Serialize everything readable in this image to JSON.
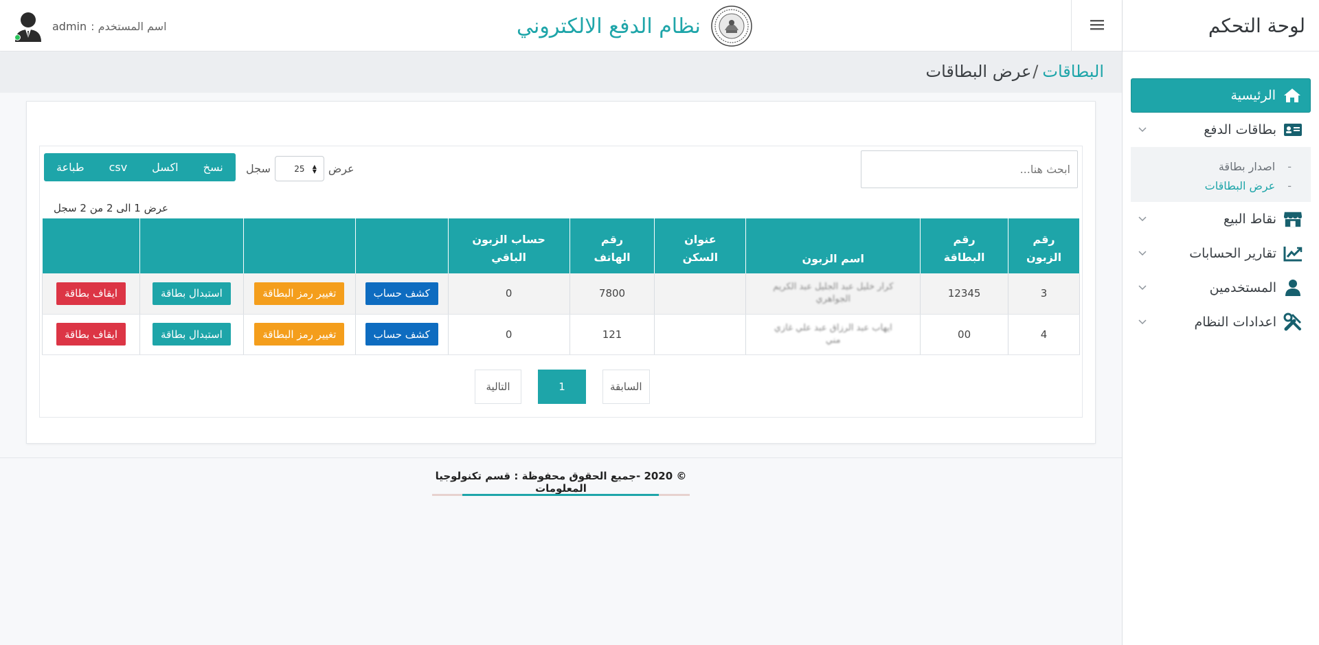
{
  "sidebar": {
    "title": "لوحة التحكم",
    "items": [
      {
        "label": "الرئيسية",
        "icon": "home-icon"
      },
      {
        "label": "بطاقات الدفع",
        "icon": "id-card-icon"
      },
      {
        "label": "نقاط البيع",
        "icon": "store-icon"
      },
      {
        "label": "تقارير الحسابات",
        "icon": "chart-line-icon"
      },
      {
        "label": "المستخدمين",
        "icon": "user-icon"
      },
      {
        "label": "اعدادات النظام",
        "icon": "tools-icon"
      }
    ],
    "submenu": [
      {
        "label": "اصدار بطاقة"
      },
      {
        "label": "عرض البطاقات"
      }
    ],
    "dash": "-"
  },
  "header": {
    "title": "نظام الدفع الالكتروني",
    "user_label": "اسم المستخدم :",
    "username": "admin"
  },
  "breadcrumb": {
    "parent": "البطاقات",
    "separator": "/",
    "current": "عرض البطاقات"
  },
  "toolbar": {
    "search_placeholder": "ابحث هنا...",
    "show_label": "عرض",
    "page_size": "25",
    "records_label": "سجل",
    "export_buttons": [
      "نسخ",
      "اكسل",
      "csv",
      "طباعة"
    ]
  },
  "info": "عرض 1 الى 2 من 2 سجل",
  "table": {
    "headers": [
      [
        "رقم",
        "الزبون"
      ],
      [
        "رقم",
        "البطاقة"
      ],
      [
        "اسم الزبون",
        ""
      ],
      [
        "عنوان",
        "السكن"
      ],
      [
        "رقم",
        "الهاتف"
      ],
      [
        "حساب الزبون",
        "الباقي"
      ],
      [
        "",
        ""
      ],
      [
        "",
        ""
      ],
      [
        "",
        ""
      ],
      [
        "",
        ""
      ]
    ],
    "rows": [
      {
        "customer_no": "3",
        "card_no": "12345",
        "name_line1": "كرار خليل عبد الجليل عبد الكريم",
        "name_line2": "الجواهري",
        "address": "",
        "phone": "7800",
        "balance": "0"
      },
      {
        "customer_no": "4",
        "card_no": "00",
        "name_line1": "ايهاب عبد الرزاق عبد علي غازي",
        "name_line2": "مني",
        "address": "",
        "phone": "121",
        "balance": "0"
      }
    ],
    "actions": {
      "statement": "كشف حساب",
      "change_pin": "تغيير رمز البطاقة",
      "replace": "استبدال بطاقة",
      "suspend": "ايقاف بطاقة"
    }
  },
  "pagination": {
    "previous": "السابقة",
    "current": "1",
    "next": "التالية"
  },
  "footer": {
    "text": "© 2020 -جميع الحقوق محفوظة : قسم تكنولوجيا المعلومات"
  },
  "colors": {
    "accent": "#1ea5a9",
    "blue_button": "#0e6cc0",
    "orange_button": "#f49e1c",
    "red_button": "#dc3545"
  }
}
